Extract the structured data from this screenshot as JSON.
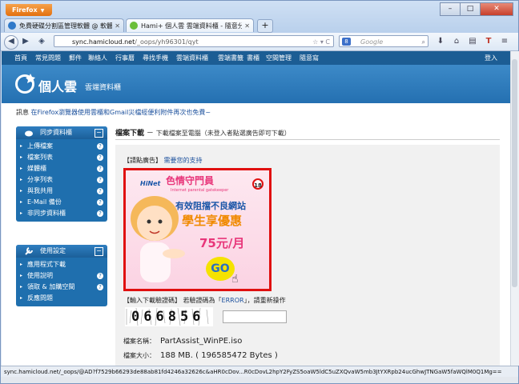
{
  "browser": {
    "menu_button": "Firefox",
    "tabs": [
      {
        "title": "免費硬碟分割區管理軟體 @ 軟體使..."
      },
      {
        "title": "Hami+ 個人雲 雲端資料櫃 - 隨意分..."
      }
    ],
    "new_tab": "+",
    "url_host": "sync.hamicloud.net",
    "url_path": "/_oops/yh96301/qyt",
    "search_placeholder": "Google",
    "status_url": "sync.hamicloud.net/_oops/@AD?f7529b66293de88ab81fd4246a32626c&aHR0cDov...R0cDovL2hpY2FyZS5oaW5ldC5uZXQvaW5mb3JtYXRpb24ucGhwJTNGaW5faWQlM0Q1Mg=="
  },
  "site": {
    "top_menu": [
      "首頁",
      "常見問題",
      "郵件",
      "聯絡人",
      "行事曆",
      "尋找手機",
      "雲端資料櫃",
      "雲端書籤",
      "書櫃",
      "空間管理",
      "隨意寫"
    ],
    "login": "登入",
    "logo_text": "個人雲",
    "logo_sub": "雲端資料櫃",
    "logo_mark": "Hami",
    "notice_prefix": "訊息",
    "notice_link": "在Firefox瀏覽器使用雲櫃和Gmail災檔經便利附件再次也免費~"
  },
  "sidebar": {
    "panel1_title": "同步資料櫃",
    "panel1_items": [
      "上傳檔案",
      "檔案列表",
      "媒體櫃",
      "分享列表",
      "與我共用",
      "E-Mail 備份",
      "非同步資料櫃"
    ],
    "panel2_title": "使用設定",
    "panel2_items": [
      "應用程式下載",
      "使用說明",
      "領取 & 加購空間",
      "反應問題"
    ]
  },
  "main": {
    "title": "檔案下載",
    "dash": "－",
    "subtitle": "下載檔案至電腦（未登入者點選廣告即可下載）",
    "ad_label": "【請點廣告】",
    "ad_link": "需要您的支持",
    "ad": {
      "brand": "HiNet",
      "line1": "色情守門員",
      "line1_small": "Internet parental gatekeeper",
      "line2": "有效阻擋不良網站",
      "line3": "學生享優惠",
      "line4": "75元/月",
      "go": "GO"
    },
    "captcha_label": "【輸入下載驗證碼】",
    "captcha_hint_pre": "若驗證碼為「",
    "captcha_hint_err": "ERROR",
    "captcha_hint_post": "」，請重新操作",
    "captcha_text": "066856",
    "file_name_label": "檔案名稱：",
    "file_name": "PartAssist_WinPE.iso",
    "file_size_label": "檔案大小：",
    "file_size": "188 MB. ( 196585472 Bytes )"
  }
}
